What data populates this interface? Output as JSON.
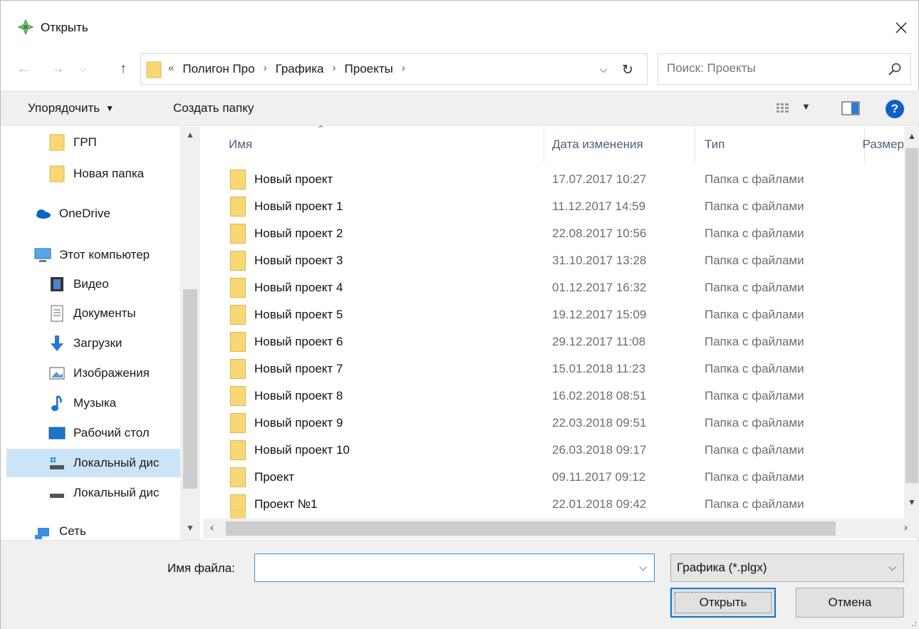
{
  "window": {
    "title": "Открыть"
  },
  "nav": {
    "breadcrumb_prefix": "«",
    "crumbs": [
      "Полигон Про",
      "Графика",
      "Проекты"
    ],
    "search_placeholder": "Поиск: Проекты"
  },
  "toolbar": {
    "organize_label": "Упорядочить",
    "new_folder_label": "Создать папку",
    "help_label": "?"
  },
  "sidebar": {
    "items": [
      {
        "label": "ГРП",
        "icon": "folder-icon"
      },
      {
        "label": "Новая папка",
        "icon": "folder-icon"
      },
      {
        "label": "OneDrive",
        "icon": "cloud-icon"
      },
      {
        "label": "Этот компьютер",
        "icon": "computer-icon"
      },
      {
        "label": "Видео",
        "icon": "video-icon"
      },
      {
        "label": "Документы",
        "icon": "document-icon"
      },
      {
        "label": "Загрузки",
        "icon": "download-icon"
      },
      {
        "label": "Изображения",
        "icon": "image-icon"
      },
      {
        "label": "Музыка",
        "icon": "music-icon"
      },
      {
        "label": "Рабочий стол",
        "icon": "desktop-icon"
      },
      {
        "label": "Локальный дис",
        "icon": "local-disk-icon"
      },
      {
        "label": "Локальный дис",
        "icon": "drive-icon"
      },
      {
        "label": "Сеть",
        "icon": "network-icon"
      }
    ]
  },
  "columns": {
    "name": "Имя",
    "date": "Дата изменения",
    "type": "Тип",
    "size": "Размер"
  },
  "files": [
    {
      "name": "Новый проект",
      "date": "17.07.2017 10:27",
      "type": "Папка с файлами"
    },
    {
      "name": "Новый проект 1",
      "date": "11.12.2017 14:59",
      "type": "Папка с файлами"
    },
    {
      "name": "Новый проект 2",
      "date": "22.08.2017 10:56",
      "type": "Папка с файлами"
    },
    {
      "name": "Новый проект 3",
      "date": "31.10.2017 13:28",
      "type": "Папка с файлами"
    },
    {
      "name": "Новый проект 4",
      "date": "01.12.2017 16:32",
      "type": "Папка с файлами"
    },
    {
      "name": "Новый проект 5",
      "date": "19.12.2017 15:09",
      "type": "Папка с файлами"
    },
    {
      "name": "Новый проект 6",
      "date": "29.12.2017 11:08",
      "type": "Папка с файлами"
    },
    {
      "name": "Новый проект 7",
      "date": "15.01.2018 11:23",
      "type": "Папка с файлами"
    },
    {
      "name": "Новый проект 8",
      "date": "16.02.2018 08:51",
      "type": "Папка с файлами"
    },
    {
      "name": "Новый проект 9",
      "date": "22.03.2018 09:51",
      "type": "Папка с файлами"
    },
    {
      "name": "Новый проект 10",
      "date": "26.03.2018 09:17",
      "type": "Папка с файлами"
    },
    {
      "name": "Проект",
      "date": "09.11.2017 09:12",
      "type": "Папка с файлами"
    },
    {
      "name": "Проект №1",
      "date": "22.01.2018 09:42",
      "type": "Папка с файлами"
    }
  ],
  "bottom": {
    "filename_label": "Имя файла:",
    "filename_value": "",
    "filter_value": "Графика (*.plgx)",
    "open_label": "Открыть",
    "cancel_label": "Отмена"
  },
  "colors": {
    "accent": "#0078d7",
    "folder": "#f8d775",
    "selected_bg": "#cce4f7",
    "help": "#1160c7"
  }
}
